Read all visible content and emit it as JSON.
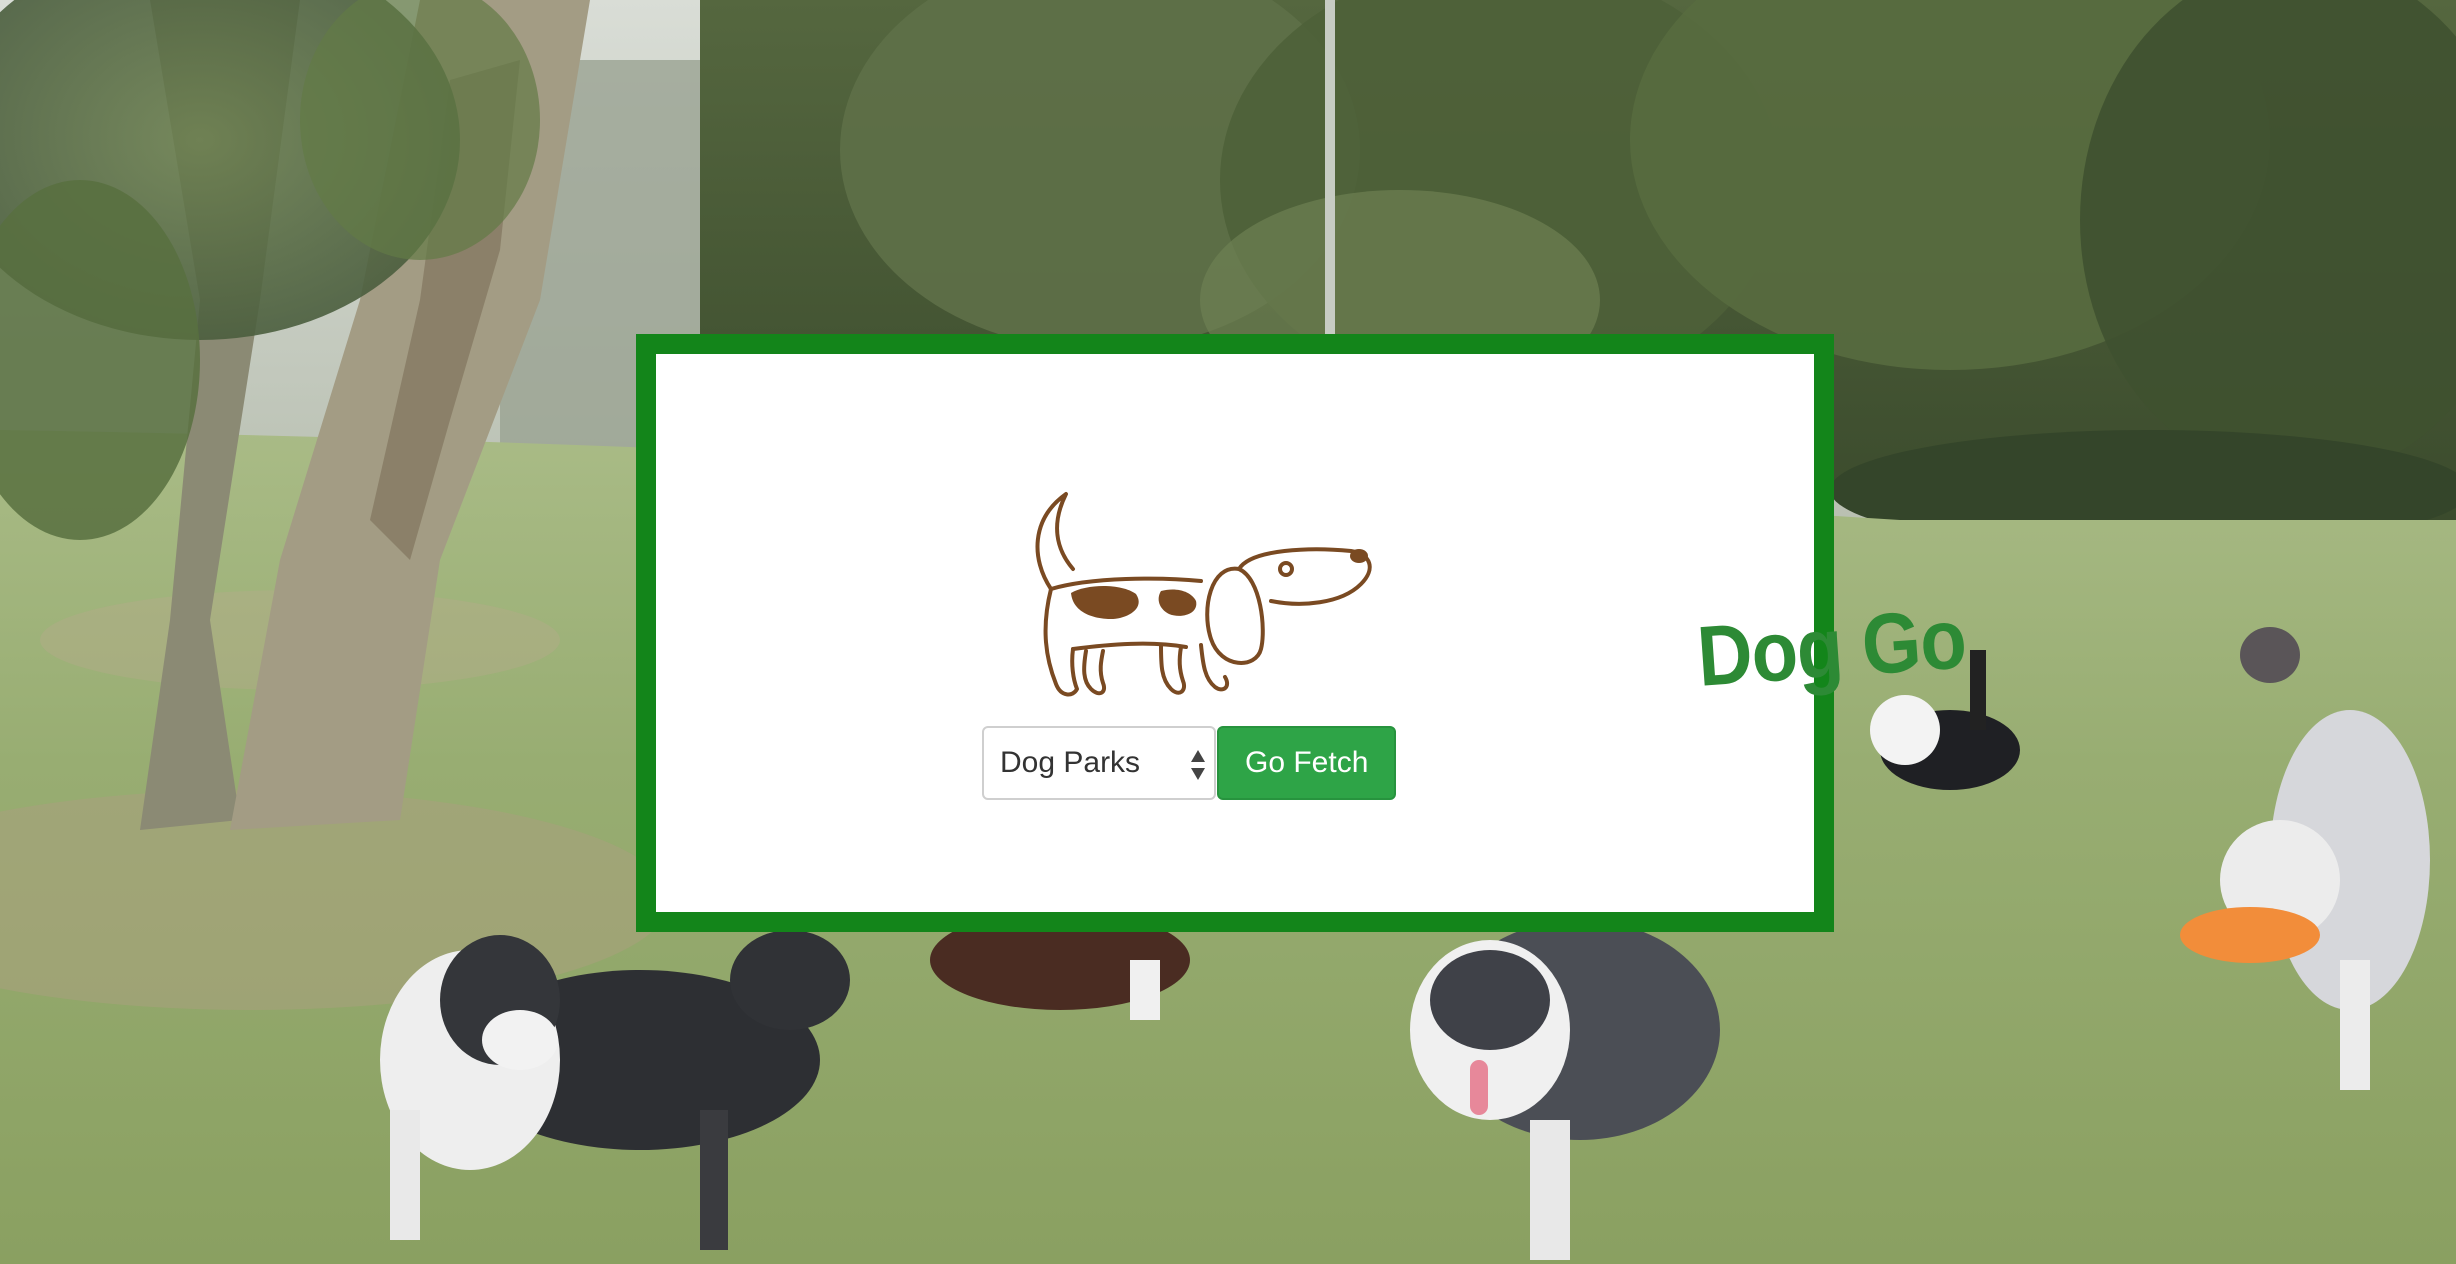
{
  "brand": {
    "name": "Dog Go",
    "color": "#2d8a35",
    "mascot_color": "#7a4a22"
  },
  "search": {
    "category_selected": "Dog Parks",
    "submit_label": "Go Fetch",
    "button_color": "#2ea447"
  },
  "card": {
    "border_color": "#13851a"
  },
  "background": {
    "description_icon": "dog-park-photo"
  }
}
